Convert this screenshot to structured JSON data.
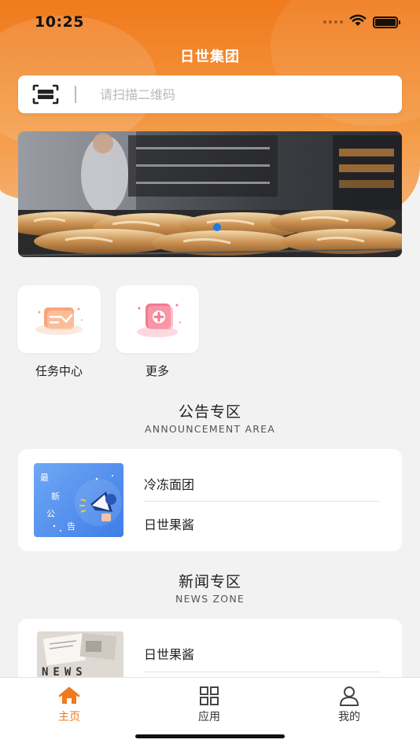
{
  "status_bar": {
    "time": "10:25"
  },
  "header": {
    "title": "日世集团"
  },
  "scan": {
    "placeholder": "请扫描二维码",
    "icon": "scan-frame-icon"
  },
  "banner": {
    "image": "bakery-bread-photo",
    "active_dot_index": 0
  },
  "quick_actions": [
    {
      "label": "任务中心",
      "icon": "task-center-icon"
    },
    {
      "label": "更多",
      "icon": "more-apps-icon"
    }
  ],
  "announcement": {
    "title": "公告专区",
    "subtitle": "ANNOUNCEMENT AREA",
    "thumb_text": [
      "最",
      "新",
      "公",
      "告"
    ],
    "items": [
      "冷冻面团",
      "日世果酱"
    ]
  },
  "news": {
    "title": "新闻专区",
    "subtitle": "NEWS ZONE",
    "thumb_text": "NEWS",
    "items": [
      "日世果酱"
    ]
  },
  "tabbar": {
    "active": "主页",
    "tabs": [
      {
        "label": "主页",
        "icon": "home-icon"
      },
      {
        "label": "应用",
        "icon": "apps-grid-icon"
      },
      {
        "label": "我的",
        "icon": "user-icon"
      }
    ]
  },
  "colors": {
    "accent": "#f07a1c",
    "page_bg": "#f2f2f2",
    "dot_active": "#1f7ae0"
  }
}
